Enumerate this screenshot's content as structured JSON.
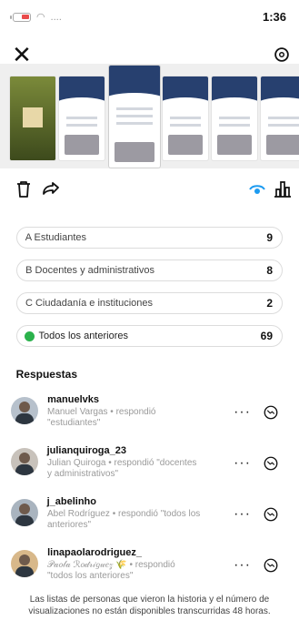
{
  "status_bar": {
    "time": "1:36"
  },
  "options": [
    {
      "letter": "A",
      "label": "Estudiantes",
      "count": "9"
    },
    {
      "letter": "B",
      "label": "Docentes y administrativos",
      "count": "8"
    },
    {
      "letter": "C",
      "label": "Ciudadanía e instituciones",
      "count": "2"
    },
    {
      "letter": "",
      "label": "Todos los anteriores",
      "count": "69"
    }
  ],
  "responses_title": "Respuestas",
  "responses": [
    {
      "username": "manuelvks",
      "detail": "Manuel Vargas • respondió \"estudiantes\""
    },
    {
      "username": "julianquiroga_23",
      "detail": "Julian Quiroga • respondió \"docentes y administrativos\""
    },
    {
      "username": "j_abelinho",
      "detail": "Abel Rodríguez • respondió \"todos los anteriores\""
    },
    {
      "username": "linapaolarodriguez_",
      "detail": "𝒫𝒶𝑜𝓁𝒶 ℛ𝑜𝒹𝓇𝒾𝑔𝓊𝑒𝓏 🌾 • respondió \"todos los anteriores\""
    }
  ],
  "footer_note": "Las listas de personas que vieron la historia y el número de visualizaciones no están disponibles transcurridas 48 horas."
}
